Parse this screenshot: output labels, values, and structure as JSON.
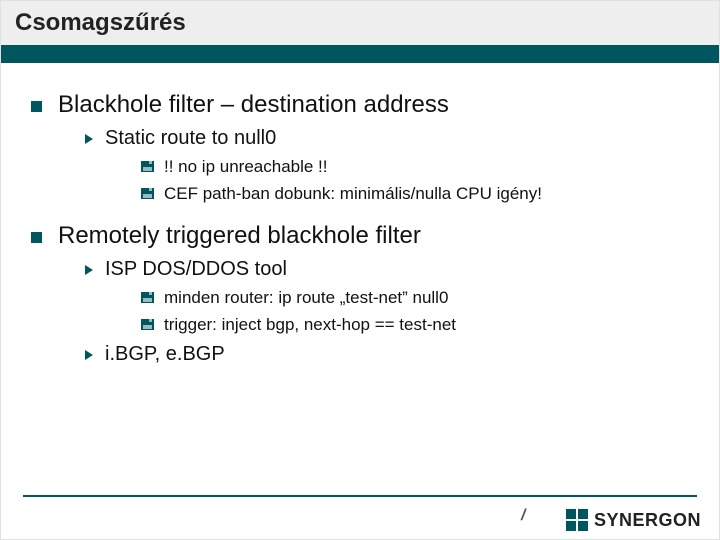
{
  "slide": {
    "title": "Csomagszűrés",
    "bullets": [
      {
        "text": "Blackhole filter – destination address",
        "children": [
          {
            "text": "Static route to null0",
            "children": [
              {
                "text": "!! no ip unreachable !!"
              },
              {
                "text": "CEF path-ban dobunk: minimális/nulla CPU igény!"
              }
            ]
          }
        ]
      },
      {
        "text": "Remotely triggered blackhole filter",
        "children": [
          {
            "text": "ISP DOS/DDOS tool",
            "children": [
              {
                "text": "minden router: ip route „test-net” null0"
              },
              {
                "text": "trigger: inject bgp, next-hop == test-net"
              }
            ]
          },
          {
            "text": "i.BGP, e.BGP",
            "children": []
          }
        ]
      }
    ]
  },
  "footer": {
    "slash": "/",
    "logo_text": "SYNERGON"
  },
  "colors": {
    "accent": "#00565f"
  }
}
